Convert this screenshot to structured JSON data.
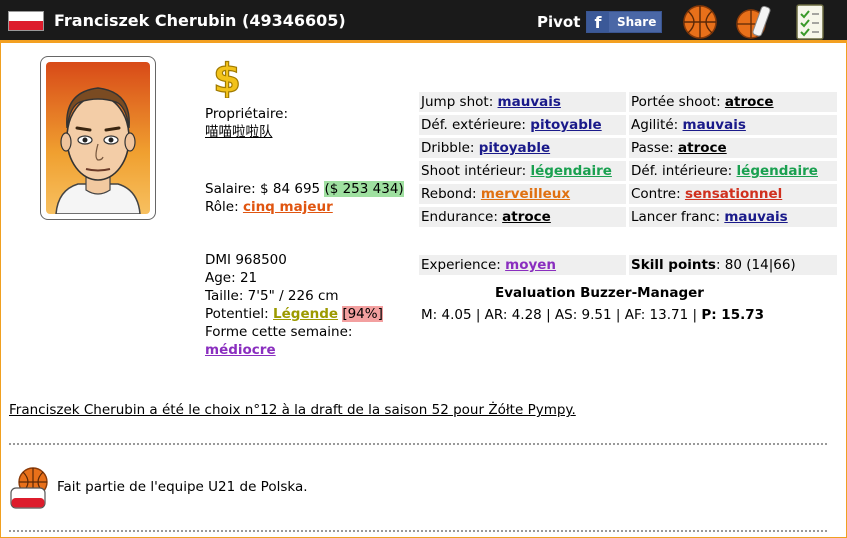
{
  "header": {
    "title": "Franciszek Cherubin (49346605)",
    "position": "Pivot",
    "share_letter": "f",
    "share_label": "Share",
    "flag_icon": "poland-flag-icon",
    "icons": [
      "basketball-icon",
      "basketball-bottle-icon",
      "checklist-icon"
    ]
  },
  "left": {
    "owner_label": "Propriétaire:",
    "owner_name": "喵喵啦啦队",
    "salary_label": "Salaire: $ 84 695 ",
    "salary_extra": "($ 253 434)",
    "role_label": "Rôle: ",
    "role_value": "cinq majeur",
    "dmi": "DMI 968500",
    "age": "Age: 21",
    "height": "Taille: 7'5\" / 226 cm",
    "potential_label": "Potentiel: ",
    "potential_value": "Légende",
    "potential_pct": "[94%]",
    "form_label": "Forme cette semaine:",
    "form_value": "médiocre"
  },
  "skills": [
    {
      "label": "Jump shot: ",
      "value": "mauvais",
      "color": "#1a1a8a"
    },
    {
      "label": "Portée shoot: ",
      "value": "atroce",
      "color": "#000000"
    },
    {
      "label": "Déf. extérieure: ",
      "value": "pitoyable",
      "color": "#1a1a8a"
    },
    {
      "label": "Agilité: ",
      "value": "mauvais",
      "color": "#1a1a8a"
    },
    {
      "label": "Dribble: ",
      "value": "pitoyable",
      "color": "#1a1a8a"
    },
    {
      "label": "Passe: ",
      "value": "atroce",
      "color": "#000000"
    },
    {
      "label": "Shoot intérieur: ",
      "value": "légendaire",
      "color": "#1aa050"
    },
    {
      "label": "Déf. intérieure: ",
      "value": "légendaire",
      "color": "#1aa050"
    },
    {
      "label": "Rebond: ",
      "value": "merveilleux",
      "color": "#e07010"
    },
    {
      "label": "Contre: ",
      "value": "sensationnel",
      "color": "#d0301e"
    },
    {
      "label": "Endurance: ",
      "value": "atroce",
      "color": "#000000"
    },
    {
      "label": "Lancer franc: ",
      "value": "mauvais",
      "color": "#1a1a8a"
    }
  ],
  "experience": {
    "label": "Experience: ",
    "value": "moyen"
  },
  "skill_points": {
    "label": "Skill points",
    "value": ": 80 (14|66)"
  },
  "evaluation": {
    "title": "Evaluation Buzzer-Manager",
    "line": "M: 4.05 | AR: 4.28 | AS: 9.51 | AF: 13.71 | ",
    "p_value": "P: 15.73"
  },
  "draft_text": "Franciszek Cherubin a été le choix n°12 à la draft de la saison 52 pour Żółte Pympy.",
  "team_text": "Fait partie de l'equipe U21 de Polska."
}
